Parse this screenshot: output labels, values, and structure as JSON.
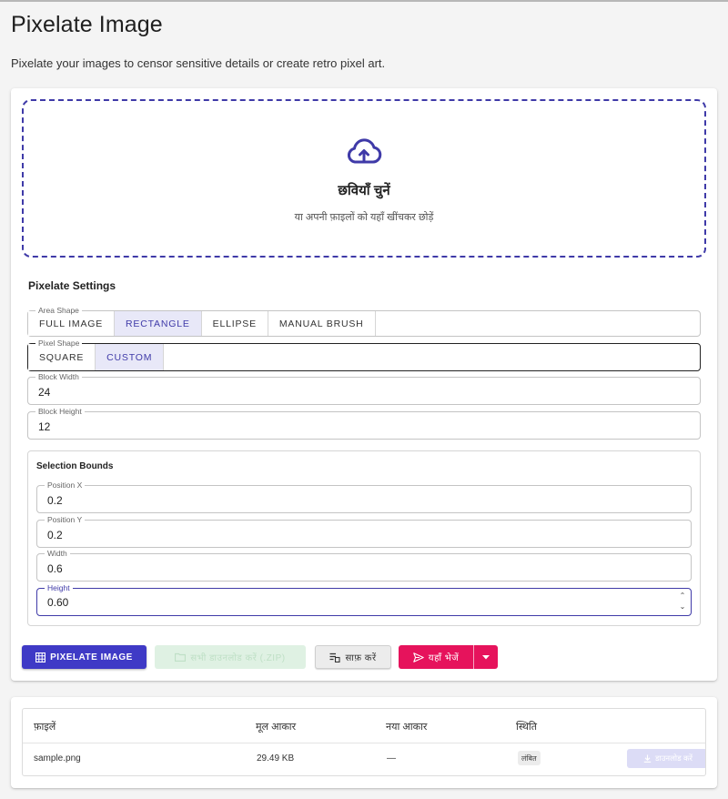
{
  "page": {
    "title": "Pixelate Image",
    "subtitle": "Pixelate your images to censor sensitive details or create retro pixel art."
  },
  "upload": {
    "icon": "cloud-upload-icon",
    "title": "छवियाँ चुनें",
    "hint": "या अपनी फ़ाइलों को यहाँ खींचकर छोड़ें"
  },
  "settings": {
    "title": "Pixelate Settings",
    "area_shape": {
      "label": "Area Shape",
      "options": [
        "FULL IMAGE",
        "RECTANGLE",
        "ELLIPSE",
        "MANUAL BRUSH"
      ],
      "selected": "RECTANGLE"
    },
    "pixel_shape": {
      "label": "Pixel Shape",
      "options": [
        "SQUARE",
        "CUSTOM"
      ],
      "selected": "CUSTOM"
    },
    "block_width": {
      "label": "Block Width",
      "value": "24"
    },
    "block_height": {
      "label": "Block Height",
      "value": "12"
    },
    "bounds": {
      "title": "Selection Bounds",
      "position_x": {
        "label": "Position X",
        "value": "0.2"
      },
      "position_y": {
        "label": "Position Y",
        "value": "0.2"
      },
      "width": {
        "label": "Width",
        "value": "0.6"
      },
      "height": {
        "label": "Height",
        "value": "0.60"
      }
    }
  },
  "actions": {
    "pixelate": "PIXELATE IMAGE",
    "download_zip": "सभी डाउनलोड करें (.ZIP)",
    "clear": "साफ़ करें",
    "send": "यहाँ भेजें"
  },
  "files_table": {
    "headers": [
      "फ़ाइलें",
      "मूल आकार",
      "नया आकार",
      "स्थिति"
    ],
    "rows": [
      {
        "name": "sample.png",
        "original_size": "29.49 KB",
        "new_size": "—",
        "status": "लंबित",
        "download": "डाउनलोड करें"
      }
    ]
  },
  "colors": {
    "accent": "#3f3ac6",
    "send": "#e6135c"
  }
}
